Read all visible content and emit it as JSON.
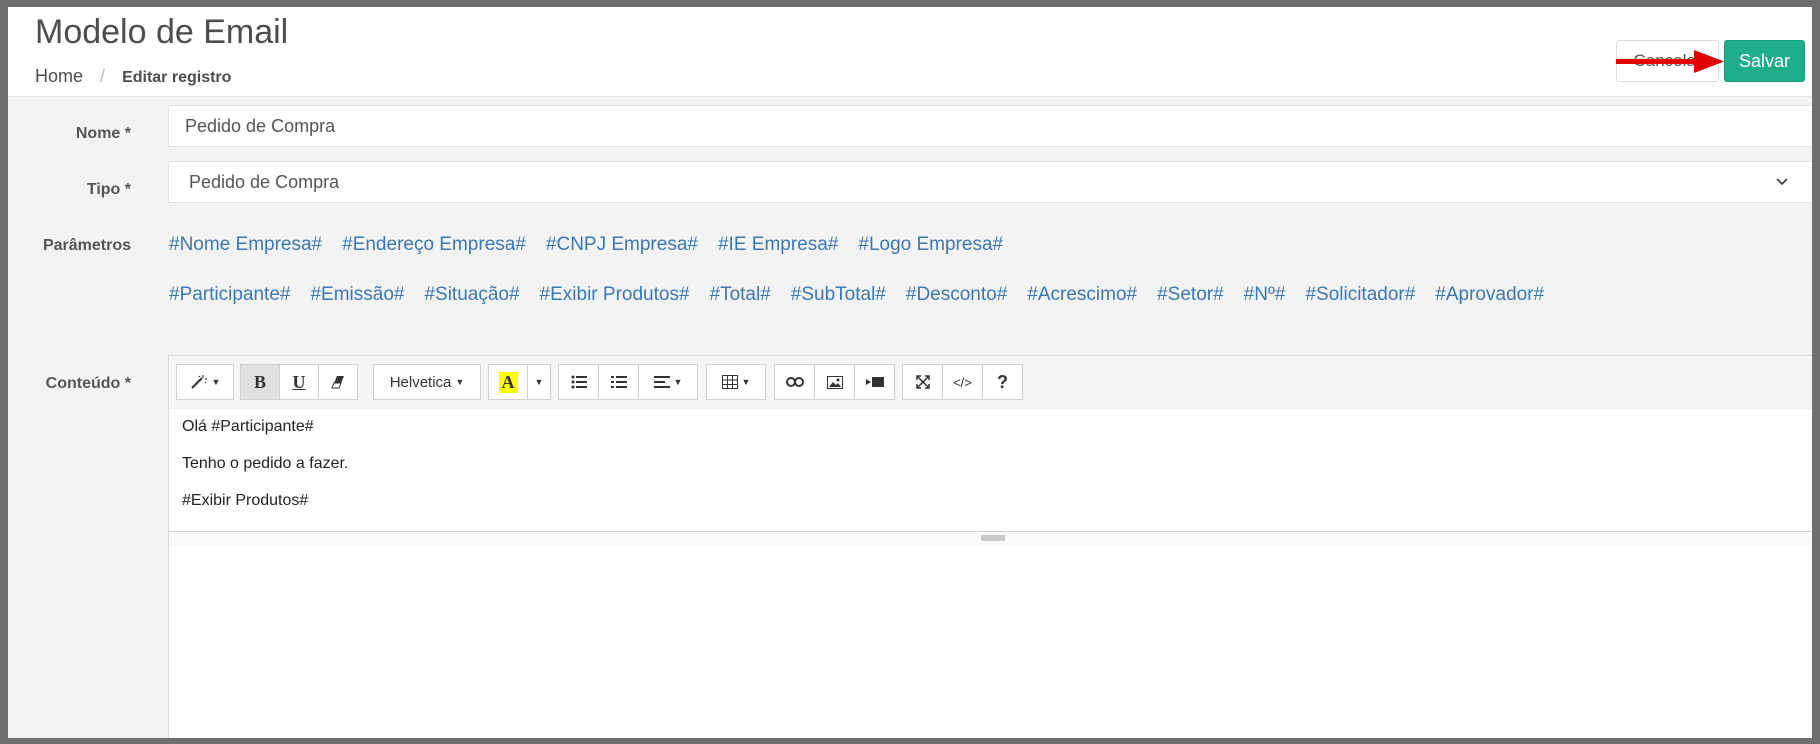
{
  "header": {
    "title": "Modelo de Email",
    "breadcrumb": {
      "home": "Home",
      "separator": "/",
      "current": "Editar registro"
    },
    "cancel_label": "Cancelar",
    "save_label": "Salvar"
  },
  "form": {
    "nome": {
      "label": "Nome *",
      "value": "Pedido de Compra"
    },
    "tipo": {
      "label": "Tipo *",
      "selected": "Pedido de Compra"
    },
    "parametros": {
      "label": "Parâmetros",
      "row1": [
        "#Nome Empresa#",
        "#Endereço Empresa#",
        "#CNPJ Empresa#",
        "#IE Empresa#",
        "#Logo Empresa#"
      ],
      "row2": [
        "#Participante#",
        "#Emissão#",
        "#Situação#",
        "#Exibir Produtos#",
        "#Total#",
        "#SubTotal#",
        "#Desconto#",
        "#Acrescimo#",
        "#Setor#",
        "#Nº#",
        "#Solicitador#",
        "#Aprovador#"
      ]
    },
    "conteudo": {
      "label": "Conteúdo *",
      "toolbar": {
        "font": "Helvetica",
        "color_letter": "A",
        "help": "?"
      },
      "lines": [
        "Olá #Participante#",
        "Tenho o pedido a fazer.",
        "#Exibir Produtos#"
      ]
    }
  },
  "colors": {
    "accent_save": "#1fae8b",
    "link": "#3a78b5",
    "annotation_arrow": "#e00000"
  },
  "icons": [
    "magic-wand-icon",
    "bold-icon",
    "underline-icon",
    "eraser-icon",
    "highlight-icon",
    "unordered-list-icon",
    "ordered-list-icon",
    "align-icon",
    "table-icon",
    "link-icon",
    "image-icon",
    "video-icon",
    "fullscreen-icon",
    "code-view-icon",
    "help-icon",
    "chevron-down-icon"
  ]
}
